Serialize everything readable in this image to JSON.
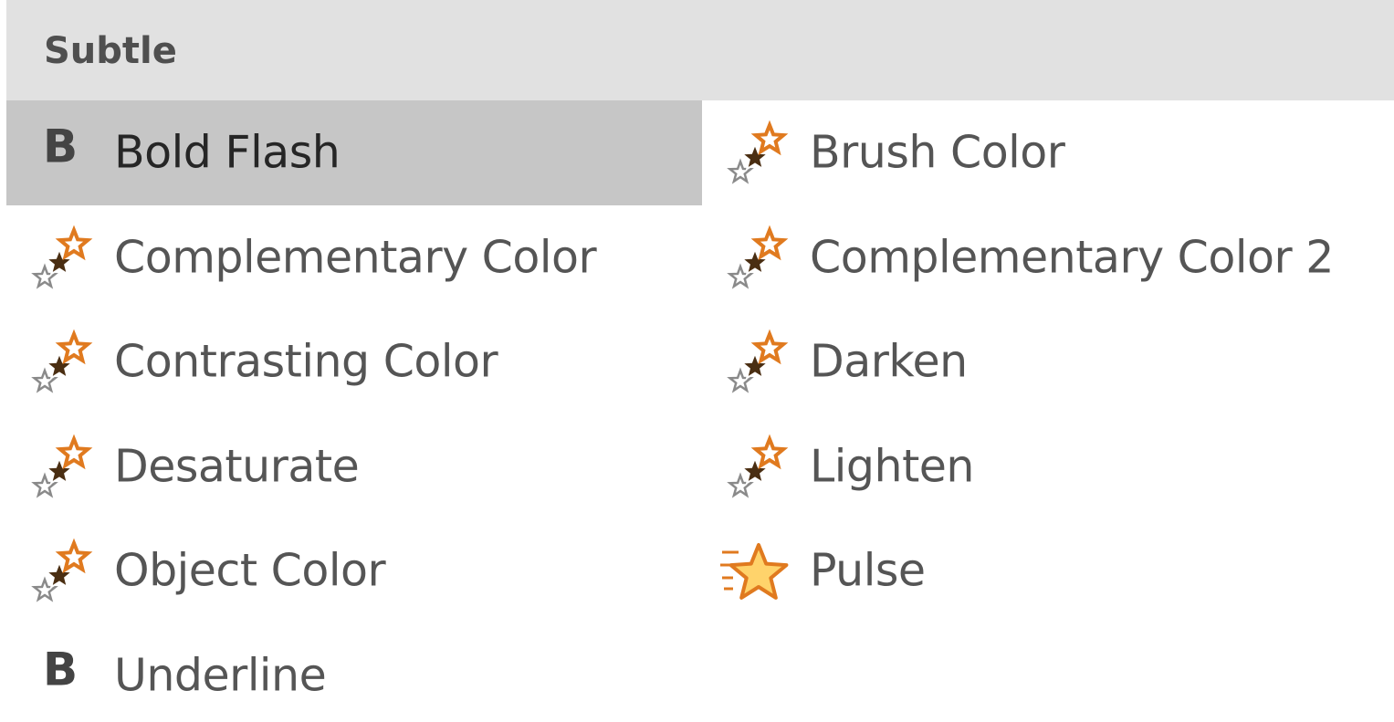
{
  "section": {
    "title": "Subtle"
  },
  "effects": [
    {
      "label": "Bold Flash",
      "icon": "bold-b-icon",
      "glyph": "B",
      "selected": true
    },
    {
      "label": "Brush Color",
      "icon": "color-star-icon"
    },
    {
      "label": "Complementary Color",
      "icon": "color-star-icon"
    },
    {
      "label": "Complementary Color 2",
      "icon": "color-star-icon"
    },
    {
      "label": "Contrasting Color",
      "icon": "color-star-icon"
    },
    {
      "label": "Darken",
      "icon": "color-star-icon"
    },
    {
      "label": "Desaturate",
      "icon": "color-star-icon"
    },
    {
      "label": "Lighten",
      "icon": "color-star-icon"
    },
    {
      "label": "Object Color",
      "icon": "color-star-icon"
    },
    {
      "label": "Pulse",
      "icon": "pulse-star-icon"
    },
    {
      "label": "Underline",
      "icon": "bold-b-icon",
      "glyph": "B"
    }
  ],
  "colors": {
    "header_bg": "#e1e1e1",
    "selected_bg": "#c6c6c6",
    "star_orange": "#e07a1f",
    "star_dark": "#4a2e12",
    "pulse_fill": "#ffd36b"
  }
}
